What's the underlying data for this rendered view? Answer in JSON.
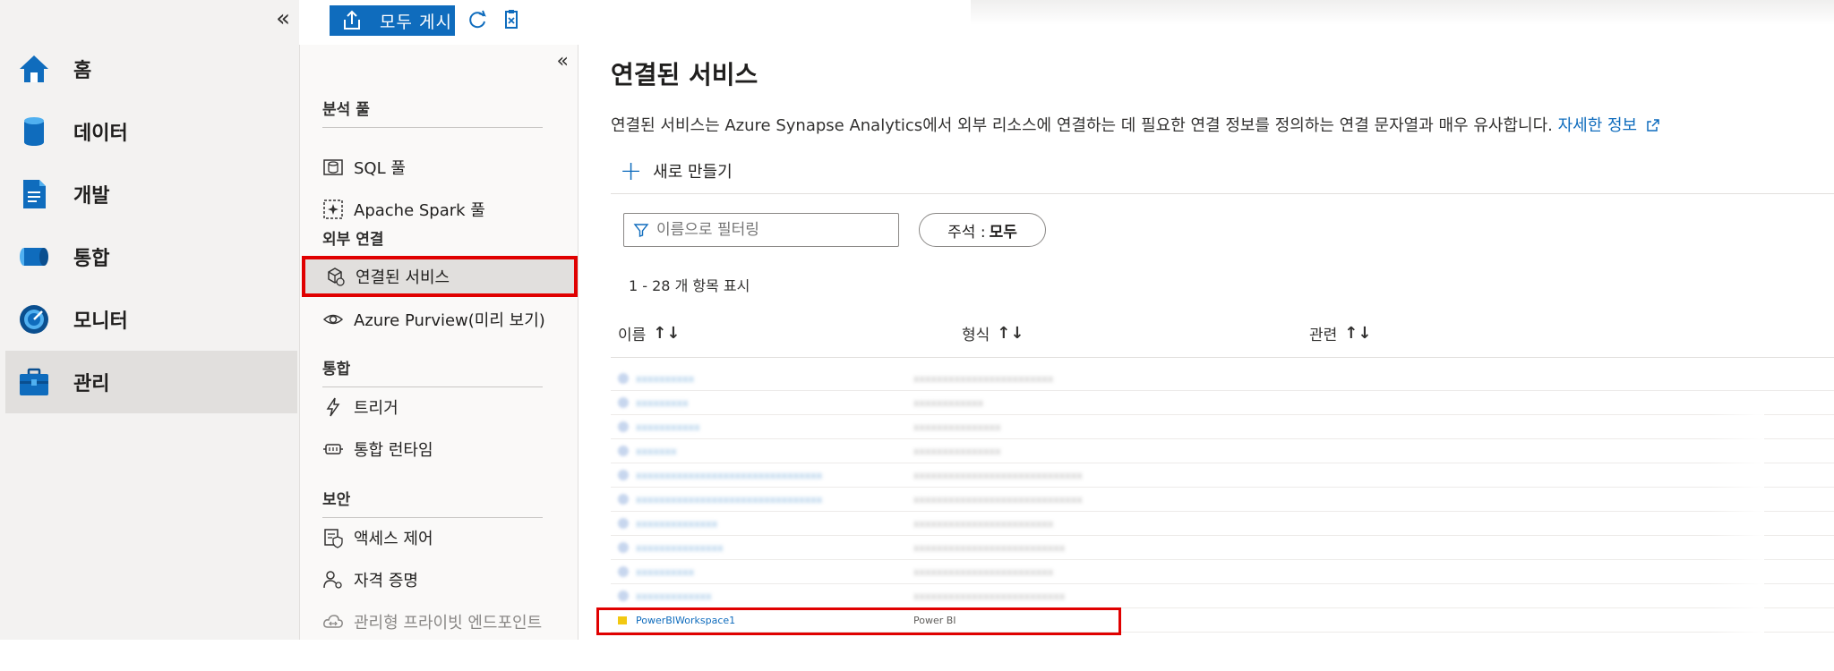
{
  "left_nav": {
    "collapse_glyph": "«",
    "items": [
      {
        "label": "홈",
        "icon": "home-icon"
      },
      {
        "label": "데이터",
        "icon": "data-icon"
      },
      {
        "label": "개발",
        "icon": "develop-icon"
      },
      {
        "label": "통합",
        "icon": "integrate-icon"
      },
      {
        "label": "모니터",
        "icon": "monitor-icon"
      },
      {
        "label": "관리",
        "icon": "manage-icon",
        "active": true
      }
    ]
  },
  "toolbar": {
    "publish_label": "모두 게시",
    "refresh_icon": "refresh-icon",
    "discard_icon": "discard-icon"
  },
  "menu": {
    "collapse_glyph": "«",
    "sections": {
      "analytics": "분석 풀",
      "external": "외부 연결",
      "integration": "통합",
      "security": "보안"
    },
    "items": {
      "sql_pools": "SQL 풀",
      "spark_pools": "Apache Spark 풀",
      "linked_services": "연결된 서비스",
      "purview": "Azure Purview(미리 보기)",
      "triggers": "트리거",
      "integration_runtimes": "통합 런타임",
      "access_control": "액세스 제어",
      "credentials": "자격 증명",
      "private_endpoints": "관리형 프라이빗 엔드포인트"
    }
  },
  "main": {
    "title": "연결된 서비스",
    "description": "연결된 서비스는 Azure Synapse Analytics에서 외부 리소스에 연결하는 데 필요한 연결 정보를 정의하는 연결 문자열과 매우 유사합니다.",
    "learn_more": "자세한 정보",
    "new_label": "새로 만들기",
    "filter_placeholder": "이름으로 필터링",
    "annotation_label": "주석 :",
    "annotation_value": "모두",
    "count_text": "1 - 28 개 항목 표시",
    "columns": {
      "name": "이름",
      "type": "형식",
      "related": "관련"
    },
    "sort_glyph": "↑↓",
    "rows": [
      {
        "name": "xxxxxxxxxx",
        "type": "xxxxxxxxxxxxxxxxxxxxxxxx"
      },
      {
        "name": "xxxxxxxxx",
        "type": "xxxxxxxxxxxx"
      },
      {
        "name": "xxxxxxxxxxx",
        "type": "xxxxxxxxxxxxxxx"
      },
      {
        "name": "xxxxxxx",
        "type": "xxxxxxxxxxxxxxx"
      },
      {
        "name": "xxxxxxxxxxxxxxxxxxxxxxxxxxxxxxxx",
        "type": "xxxxxxxxxxxxxxxxxxxxxxxxxxxxx"
      },
      {
        "name": "xxxxxxxxxxxxxxxxxxxxxxxxxxxxxxxx",
        "type": "xxxxxxxxxxxxxxxxxxxxxxxxxxxxx"
      },
      {
        "name": "xxxxxxxxxxxxxx",
        "type": "xxxxxxxxxxxxxxxxxxxxxxxx"
      },
      {
        "name": "xxxxxxxxxxxxxxx",
        "type": "xxxxxxxxxxxxxxxxxxxxxxxxxx"
      },
      {
        "name": "xxxxxxxxxx",
        "type": "xxxxxxxxxxxxxxxxxxxxxxxx"
      },
      {
        "name": "xxxxxxxxxxxxx",
        "type": "xxxxxxxxxxxxxxxxxxxxxxxxxx"
      },
      {
        "name": "PowerBIWorkspace1",
        "type": "Power BI",
        "clear": true
      }
    ]
  },
  "colors": {
    "accent": "#0f6cbd",
    "highlight": "#e00000",
    "nav_bg": "#f3f2f1"
  }
}
